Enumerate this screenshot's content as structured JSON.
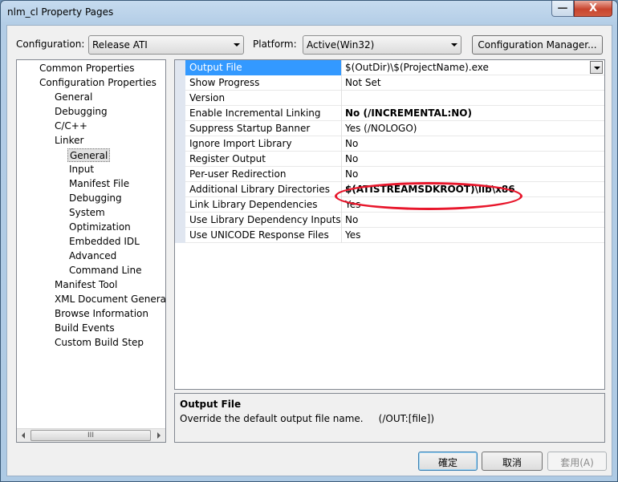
{
  "window": {
    "title": "nlm_cl Property Pages",
    "minimize_glyph": "—",
    "close_glyph": "X"
  },
  "top": {
    "configuration_label": "Configuration:",
    "configuration_value": "Release ATI",
    "platform_label": "Platform:",
    "platform_value": "Active(Win32)",
    "config_manager_label": "Configuration Manager..."
  },
  "tree": {
    "items": [
      "Common Properties",
      "Configuration Properties",
      "General",
      "Debugging",
      "C/C++",
      "Linker",
      "General",
      "Input",
      "Manifest File",
      "Debugging",
      "System",
      "Optimization",
      "Embedded IDL",
      "Advanced",
      "Command Line",
      "Manifest Tool",
      "XML Document Generator",
      "Browse Information",
      "Build Events",
      "Custom Build Step"
    ],
    "selected_index": 6,
    "scroll_thumb_glyph": "III"
  },
  "grid": {
    "rows": [
      {
        "name": "Output File",
        "value": "$(OutDir)\\$(ProjectName).exe",
        "bold": false
      },
      {
        "name": "Show Progress",
        "value": "Not Set",
        "bold": false
      },
      {
        "name": "Version",
        "value": "",
        "bold": false
      },
      {
        "name": "Enable Incremental Linking",
        "value": "No (/INCREMENTAL:NO)",
        "bold": true
      },
      {
        "name": "Suppress Startup Banner",
        "value": "Yes (/NOLOGO)",
        "bold": false
      },
      {
        "name": "Ignore Import Library",
        "value": "No",
        "bold": false
      },
      {
        "name": "Register Output",
        "value": "No",
        "bold": false
      },
      {
        "name": "Per-user Redirection",
        "value": "No",
        "bold": false
      },
      {
        "name": "Additional Library Directories",
        "value": "$(ATISTREAMSDKROOT)\\lib\\x86",
        "bold": true
      },
      {
        "name": "Link Library Dependencies",
        "value": "Yes",
        "bold": false
      },
      {
        "name": "Use Library Dependency Inputs",
        "value": "No",
        "bold": false
      },
      {
        "name": "Use UNICODE Response Files",
        "value": "Yes",
        "bold": false
      }
    ],
    "selected_index": 0
  },
  "description": {
    "title": "Output File",
    "text": "Override the default output file name.     (/OUT:[file])"
  },
  "buttons": {
    "ok": "確定",
    "cancel": "取消",
    "apply": "套用(A)"
  },
  "colors": {
    "selection": "#3399ff",
    "highlight_ellipse": "#e8172c"
  }
}
